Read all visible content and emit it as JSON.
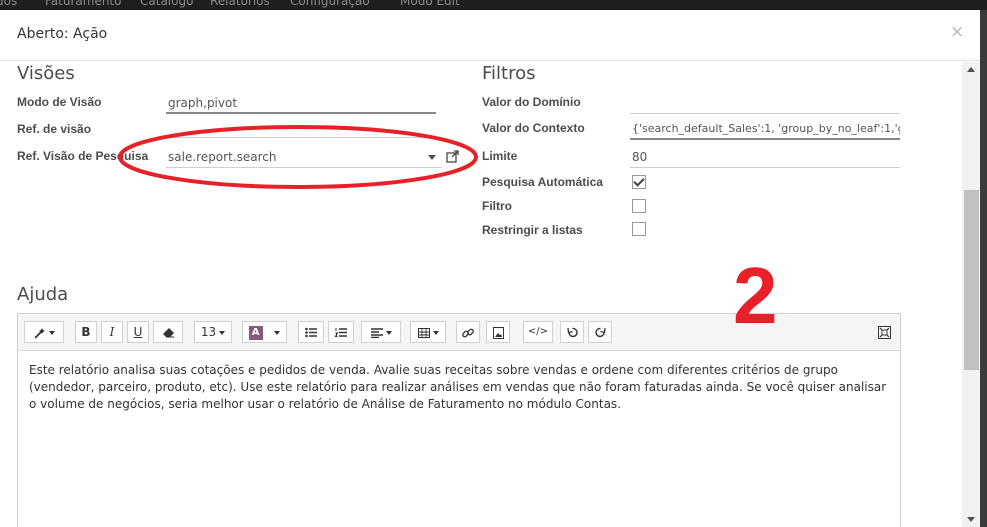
{
  "background_menu": {
    "items": [
      "dos",
      "Faturamento",
      "Catálogo",
      "Relatórios",
      "Configuração",
      "Modo Edit"
    ]
  },
  "modal": {
    "title": "Aberto: Ação",
    "close_symbol": "×"
  },
  "views_section": {
    "title": "Visões",
    "view_mode_label": "Modo de Visão",
    "view_mode_value": "graph,pivot",
    "view_ref_label": "Ref. de visão",
    "search_view_ref_label": "Ref. Visão de Pesquisa",
    "search_view_ref_value": "sale.report.search"
  },
  "filters_section": {
    "title": "Filtros",
    "domain_label": "Valor do Domínio",
    "domain_value": "",
    "context_label": "Valor do Contexto",
    "context_value": "{'search_default_Sales':1, 'group_by_no_leaf':1,'g",
    "limit_label": "Limite",
    "limit_value": "80",
    "auto_search_label": "Pesquisa Automática",
    "auto_search_checked": true,
    "filter_label": "Filtro",
    "filter_checked": false,
    "restrict_label": "Restringir a listas",
    "restrict_checked": false
  },
  "help_section": {
    "title": "Ajuda",
    "toolbar": {
      "font_size": "13",
      "color_letter": "A",
      "bold": "B",
      "italic": "I",
      "underline": "U",
      "code_label": "</>",
      "icons": [
        "magic-wand-icon",
        "bold-icon",
        "italic-icon",
        "underline-icon",
        "eraser-icon",
        "font-size-icon",
        "color-icon",
        "unordered-list-icon",
        "ordered-list-icon",
        "align-icon",
        "table-icon",
        "link-icon",
        "image-icon",
        "code-view-icon",
        "undo-icon",
        "redo-icon",
        "fullscreen-icon"
      ]
    },
    "body_text": "Este relatório analisa suas cotações e pedidos de venda. Avalie suas receitas sobre vendas e ordene com diferentes critérios de grupo (vendedor, parceiro, produto, etc). Use este relatório para realizar análises em vendas que não foram faturadas ainda. Se você quiser analisar o volume de negócios, seria melhor usar o relatório de Análise de Faturamento no módulo Contas."
  },
  "annotation": {
    "number": "2",
    "color": "#e8202a"
  },
  "colors": {
    "accent_purple": "#875a7b",
    "annotation_red": "#e8202a"
  }
}
